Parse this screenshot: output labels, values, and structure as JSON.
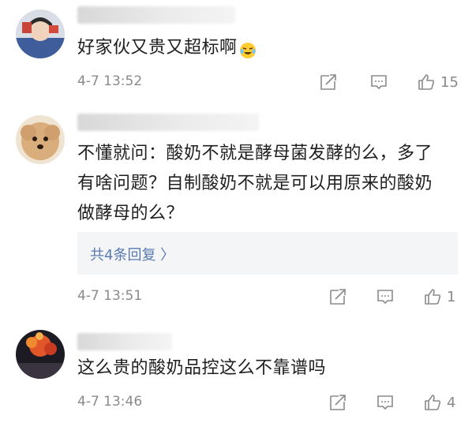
{
  "comments": [
    {
      "text": "好家伙又贵又超标啊",
      "emoji": "laughing-crying-emoji",
      "time": "4-7 13:52",
      "likes": "15"
    },
    {
      "text_lines": [
        "不懂就问：酸奶不就是酵母菌发酵的么，多了",
        "有啥问题？自制酸奶不就是可以用原来的酸奶",
        "做酵母的么？"
      ],
      "reply_link": "共4条回复 〉",
      "time": "4-7 13:51",
      "likes": "1"
    },
    {
      "text": "这么贵的酸奶品控这么不靠谱吗",
      "time": "4-7 13:46",
      "likes": "4"
    }
  ],
  "icons": {
    "share": "share-icon",
    "comment": "comment-icon",
    "like": "thumbs-up-icon"
  },
  "colors": {
    "meta_gray": "#8a8a8a",
    "reply_link": "#5a7ab0",
    "reply_bg": "#f4f5f7"
  }
}
